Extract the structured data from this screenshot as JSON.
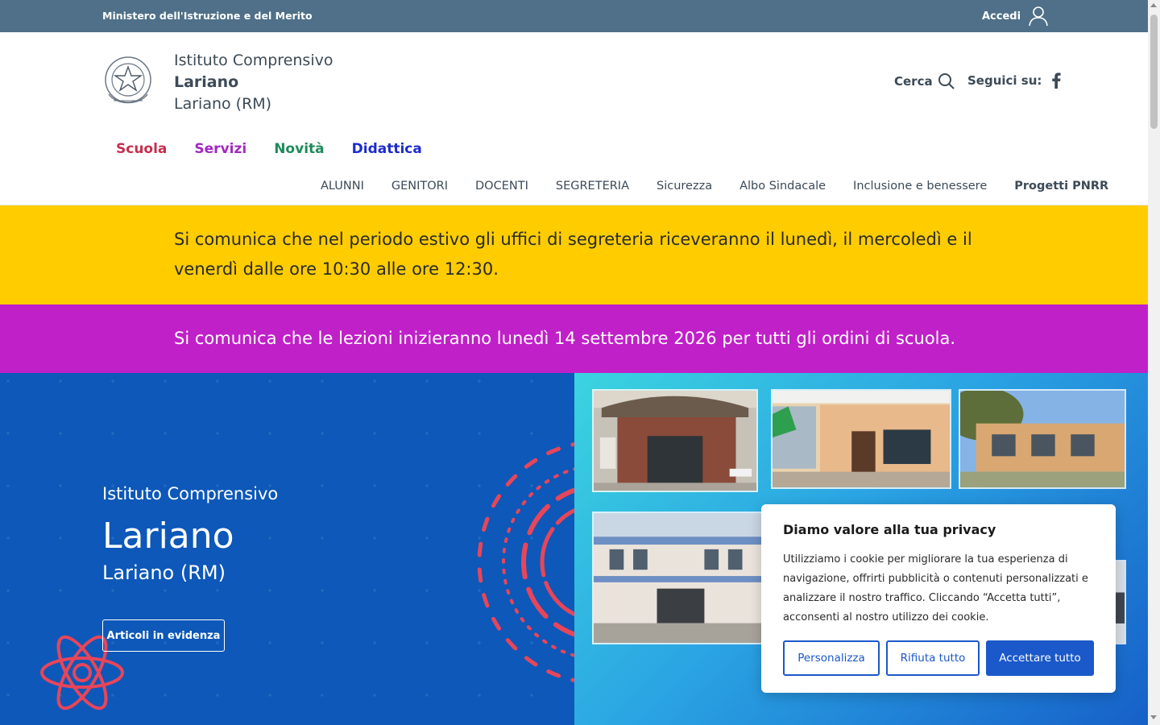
{
  "topbar": {
    "ministry": "Ministero dell'Istruzione e del Merito",
    "login_label": "Accedi",
    "login_icon": "user-icon"
  },
  "header": {
    "school_type": "Istituto Comprensivo",
    "school_name": "Lariano",
    "school_location": "Lariano (RM)",
    "search_label": "Cerca",
    "follow_label": "Seguici su:",
    "social_icon": "facebook-icon"
  },
  "main_nav": [
    {
      "label": "Scuola",
      "color": "#c72e4f"
    },
    {
      "label": "Servizi",
      "color": "#a12ac2"
    },
    {
      "label": "Novità",
      "color": "#1e8a5a"
    },
    {
      "label": "Didattica",
      "color": "#1d2cc9"
    }
  ],
  "sub_nav": [
    "ALUNNI",
    "GENITORI",
    "DOCENTI",
    "SEGRETERIA",
    "Sicurezza",
    "Albo Sindacale",
    "Inclusione e benessere",
    "Progetti PNRR"
  ],
  "notices": [
    {
      "text": "Si comunica che nel periodo estivo gli uffici di segreteria riceveranno il lunedì, il mercoledì e il venerdì dalle ore 10:30 alle ore 12:30.",
      "color": "#ffcc00"
    },
    {
      "text": "Si comunica che le lezioni inizieranno lunedì 14 settembre 2026 per tutti gli ordini di scuola.",
      "color": "#c020c8"
    }
  ],
  "hero": {
    "subtitle": "Istituto Comprensivo",
    "title": "Lariano",
    "location": "Lariano (RM)",
    "button_label": "Articoli in evidenza"
  },
  "cookie": {
    "title": "Diamo valore alla tua privacy",
    "text": "Utilizziamo i cookie per migliorare la tua esperienza di navigazione, offrirti pubblicità o contenuti personalizzati e analizzare il nostro traffico. Cliccando “Accetta tutti”, acconsenti al nostro utilizzo dei cookie.",
    "customize_label": "Personalizza",
    "reject_label": "Rifiuta tutto",
    "accept_label": "Accettare tutto",
    "accent": "#1b58c9"
  }
}
